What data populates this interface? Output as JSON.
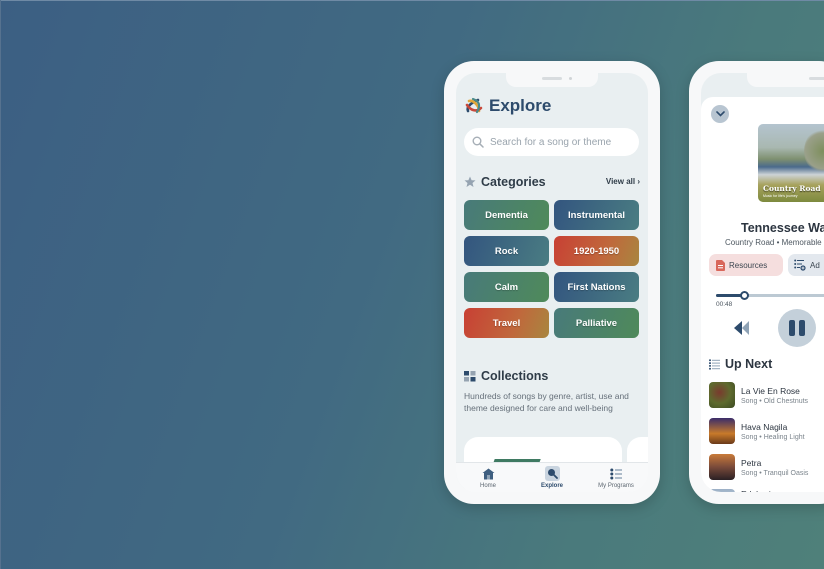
{
  "explore_screen": {
    "title": "Explore",
    "search": {
      "placeholder": "Search for a song or theme"
    },
    "categories": {
      "title": "Categories",
      "view_all": "View all",
      "items": [
        {
          "label": "Dementia",
          "style": "green"
        },
        {
          "label": "Instrumental",
          "style": "blue"
        },
        {
          "label": "Rock",
          "style": "blue"
        },
        {
          "label": "1920-1950",
          "style": "red"
        },
        {
          "label": "Calm",
          "style": "green"
        },
        {
          "label": "First Nations",
          "style": "blue"
        },
        {
          "label": "Travel",
          "style": "red"
        },
        {
          "label": "Palliative",
          "style": "green"
        }
      ]
    },
    "collections": {
      "title": "Collections",
      "description": "Hundreds of songs by genre, artist, use and theme designed for care and well-being"
    },
    "tabbar": {
      "items": [
        {
          "label": "Home",
          "icon": "home-icon",
          "active": false
        },
        {
          "label": "Explore",
          "icon": "search-icon",
          "active": true
        },
        {
          "label": "My Programs",
          "icon": "list-icon",
          "active": false
        }
      ]
    }
  },
  "player_screen": {
    "album_art": {
      "title": "Country Road",
      "subtitle": "Music for life's journey"
    },
    "track_title": "Tennessee Wa",
    "track_subtitle": "Country Road • Memorable",
    "resources_label": "Resources",
    "add_label": "Ad",
    "elapsed_time": "00:48",
    "progress_fraction": 0.2,
    "up_next": {
      "title": "Up Next",
      "items": [
        {
          "title": "La Vie En Rose",
          "subtitle": "Song • Old Chestnuts"
        },
        {
          "title": "Hava Nagila",
          "subtitle": "Song • Healing Light"
        },
        {
          "title": "Petra",
          "subtitle": "Song • Tranquil Oasis"
        },
        {
          "title": "Edelweiss",
          "subtitle": ""
        }
      ]
    }
  },
  "colors": {
    "brand_navy": "#2d4b6c",
    "category_green": "#4f8a5a",
    "category_blue": "#33557f",
    "category_red": "#c84034"
  }
}
